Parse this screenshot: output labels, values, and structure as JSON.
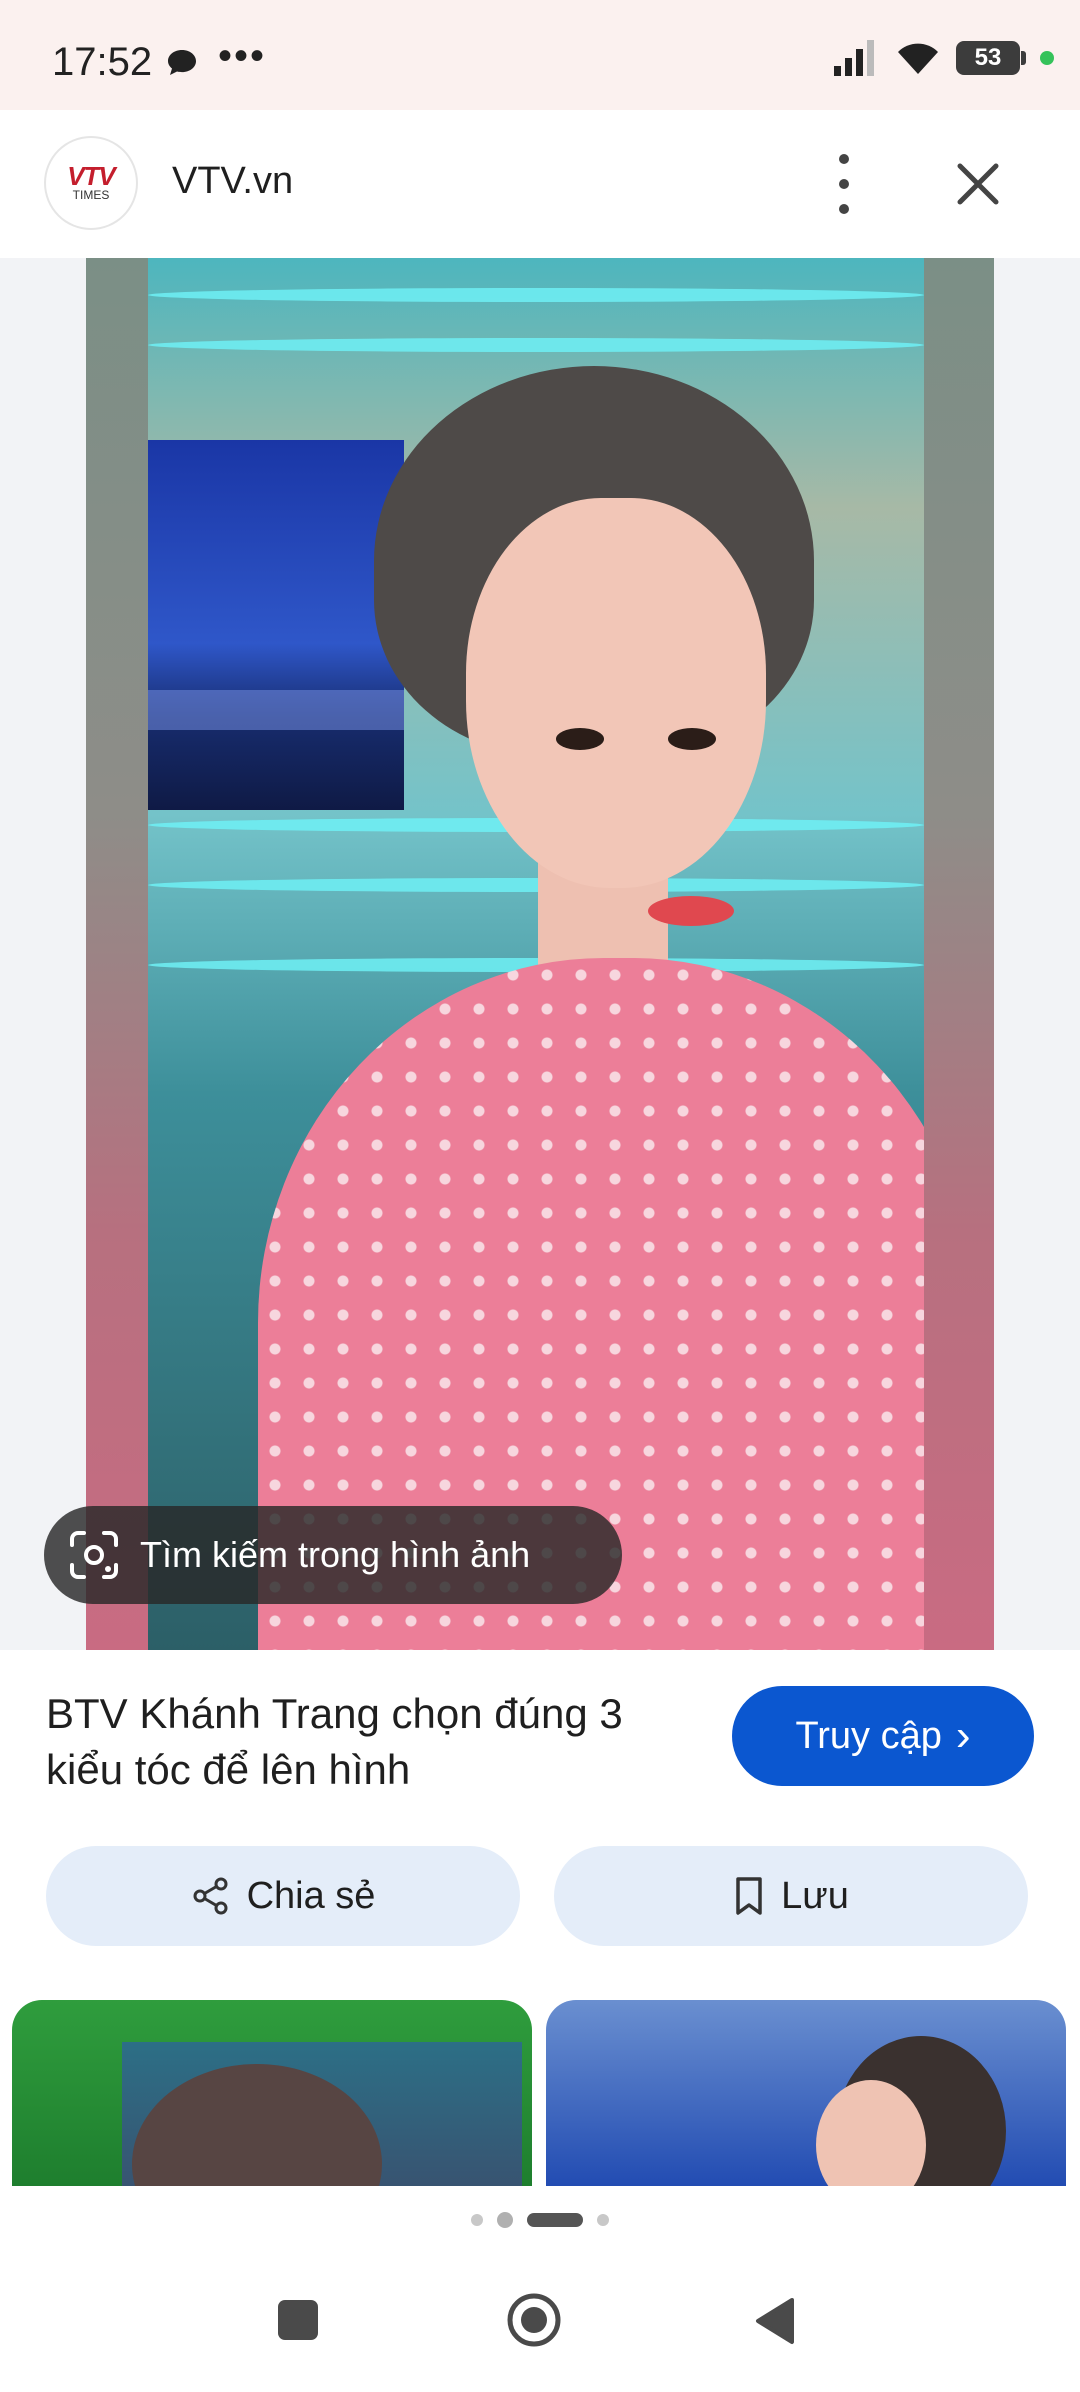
{
  "status_bar": {
    "time": "17:52",
    "battery": "53",
    "dots": "•••"
  },
  "header": {
    "logo_top": "VTV",
    "logo_bottom": "TIMES",
    "site_name": "VTV.vn"
  },
  "lens_chip": {
    "label": "Tìm kiếm trong hình ảnh"
  },
  "result": {
    "title": "BTV Khánh Trang chọn đúng 3 kiểu tóc để lên hình",
    "visit_label": "Truy cập",
    "visit_chevron": "›",
    "share_label": "Chia sẻ",
    "save_label": "Lưu"
  },
  "icons": {
    "lens": "google-lens-icon",
    "share": "share-icon",
    "bookmark": "bookmark-icon",
    "close": "close-icon",
    "more": "more-vert-icon"
  },
  "colors": {
    "status_bg": "#fbf1ef",
    "accent_blue": "#0b57d0",
    "pill_bg": "#e4edf9"
  }
}
